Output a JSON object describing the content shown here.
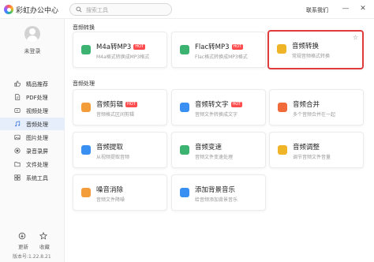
{
  "app": {
    "title": "彩虹办公中心"
  },
  "search": {
    "placeholder": "搜索工具"
  },
  "titlebar": {
    "contact": "联系我们",
    "min": "—",
    "close": "✕"
  },
  "user": {
    "login_label": "未登录"
  },
  "sidebar": {
    "items": [
      {
        "label": "精品推荐",
        "icon": "thumb-up-icon"
      },
      {
        "label": "PDF处理",
        "icon": "pdf-icon"
      },
      {
        "label": "视频处理",
        "icon": "video-icon"
      },
      {
        "label": "音频处理",
        "icon": "music-icon",
        "active": true
      },
      {
        "label": "图片处理",
        "icon": "image-icon"
      },
      {
        "label": "录音录屏",
        "icon": "record-icon"
      },
      {
        "label": "文件处理",
        "icon": "file-icon"
      },
      {
        "label": "系统工具",
        "icon": "tools-icon"
      }
    ],
    "footer": {
      "update_label": "更新",
      "favorite_label": "收藏",
      "version": "版本号:1.22.8.21"
    }
  },
  "sections": {
    "audio_convert": {
      "title": "音频转换",
      "cards": [
        {
          "title": "M4a转MP3",
          "desc": "M4a格式转换成MP3格式",
          "hot": "HOT",
          "icon": "m4a-icon",
          "color": "#3cb371"
        },
        {
          "title": "Flac转MP3",
          "desc": "Flac格式转换成MP3格式",
          "hot": "HOT",
          "icon": "flac-icon",
          "color": "#3cb371"
        },
        {
          "title": "音频转换",
          "desc": "常规音频格式转换",
          "icon": "audio-convert-icon",
          "color": "#f0b429",
          "star": "☆"
        }
      ]
    },
    "audio_process": {
      "title": "音频处理",
      "cards": [
        {
          "title": "音频剪辑",
          "desc": "音频格式区间剪辑",
          "hot": "HOT",
          "icon": "cut-icon",
          "color": "#f39c3a"
        },
        {
          "title": "音频转文字",
          "desc": "音频文件转换成文字",
          "hot": "HOT",
          "icon": "audio-to-text-icon",
          "color": "#3a8ff3"
        },
        {
          "title": "音频合并",
          "desc": "多个音频合并在一起",
          "icon": "merge-icon",
          "color": "#f06a3a"
        },
        {
          "title": "音频提取",
          "desc": "从视频提取音频",
          "icon": "extract-icon",
          "color": "#3a8ff3"
        },
        {
          "title": "音频变速",
          "desc": "音频文件变速处理",
          "icon": "speed-icon",
          "color": "#3cb371"
        },
        {
          "title": "音频调整",
          "desc": "调节音频文件音量",
          "icon": "adjust-icon",
          "color": "#f0b429"
        },
        {
          "title": "噪音消除",
          "desc": "音频文件降噪",
          "icon": "denoise-icon",
          "color": "#f39c3a"
        },
        {
          "title": "添加背景音乐",
          "desc": "给音频添加背景音乐",
          "icon": "bgm-icon",
          "color": "#3a8ff3"
        }
      ]
    }
  }
}
